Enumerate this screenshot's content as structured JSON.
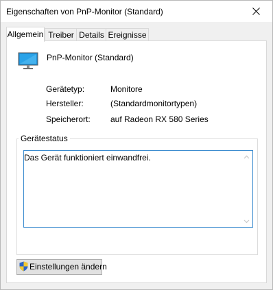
{
  "window": {
    "title": "Eigenschaften von PnP-Monitor (Standard)"
  },
  "tabs": [
    {
      "label": "Allgemein"
    },
    {
      "label": "Treiber"
    },
    {
      "label": "Details"
    },
    {
      "label": "Ereignisse"
    }
  ],
  "device": {
    "name": "PnP-Monitor (Standard)",
    "icon": "monitor-icon"
  },
  "properties": [
    {
      "label": "Gerätetyp:",
      "value": "Monitore"
    },
    {
      "label": "Hersteller:",
      "value": "(Standardmonitortypen)"
    },
    {
      "label": "Speicherort:",
      "value": "auf Radeon RX 580 Series"
    }
  ],
  "status": {
    "group_label": "Gerätestatus",
    "text": "Das Gerät funktioniert einwandfrei."
  },
  "buttons": {
    "change_settings": "Einstellungen ändern"
  },
  "colors": {
    "focus_border": "#3c8ccf",
    "monitor_blue": "#2aa3e8"
  }
}
